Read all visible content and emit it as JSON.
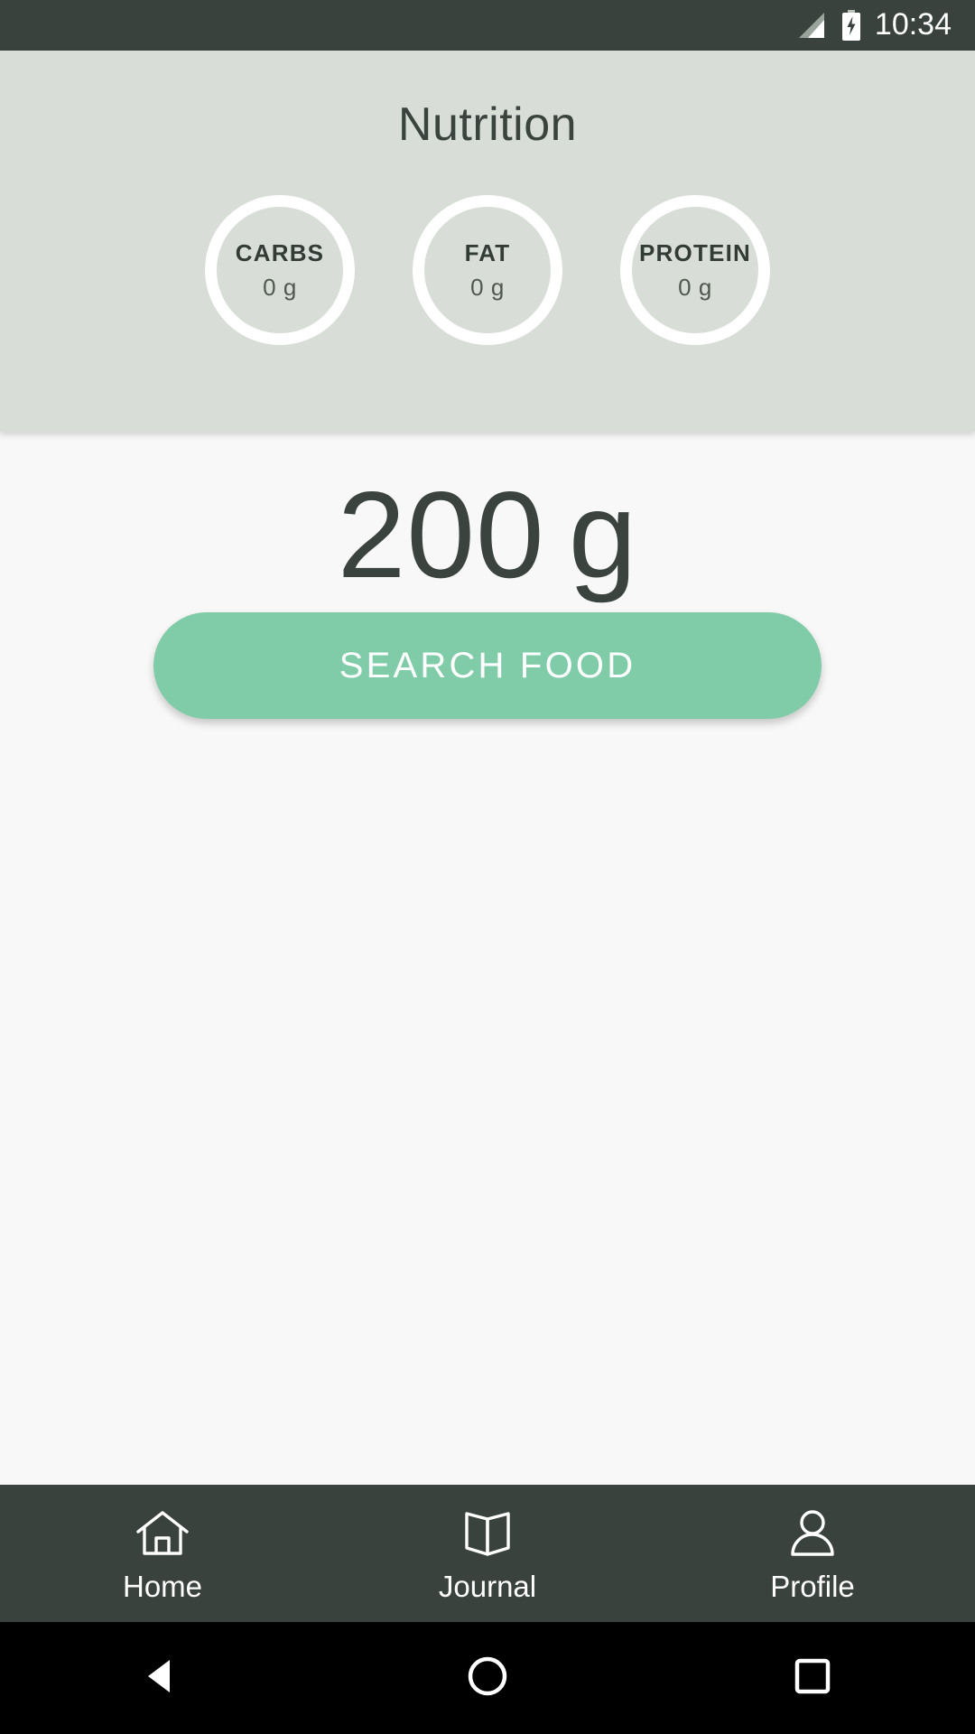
{
  "status_bar": {
    "time": "10:34",
    "signal_icon": "signal-bars-icon",
    "battery_icon": "battery-charging-icon"
  },
  "header": {
    "title": "Nutrition",
    "background_color": "#D8DDD8",
    "macros": [
      {
        "label": "CARBS",
        "value": "0 g"
      },
      {
        "label": "FAT",
        "value": "0 g"
      },
      {
        "label": "PROTEIN",
        "value": "0 g"
      }
    ]
  },
  "main": {
    "amount_number": "200",
    "amount_unit": "g",
    "search_button_label": "SEARCH FOOD",
    "accent_color": "#80CCA8",
    "text_color": "#3A433E",
    "background_color": "#F7F8F7"
  },
  "bottom_nav": {
    "background_color": "#39423D",
    "items": [
      {
        "label": "Home",
        "icon": "home-icon"
      },
      {
        "label": "Journal",
        "icon": "book-icon"
      },
      {
        "label": "Profile",
        "icon": "person-icon"
      }
    ]
  },
  "system_nav": {
    "back_icon": "back-triangle-icon",
    "home_icon": "home-circle-icon",
    "recents_icon": "recents-square-icon"
  }
}
